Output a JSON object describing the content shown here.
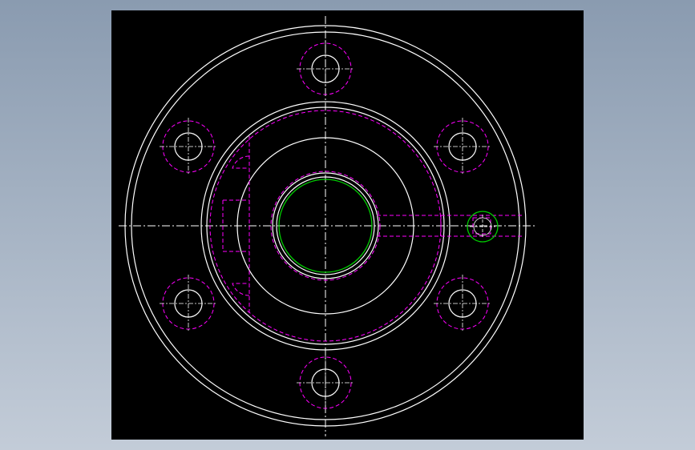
{
  "viewport": {
    "background": "#000000",
    "colors": {
      "outline": "#ffffff",
      "hidden": "#ff00ff",
      "center": "#ffffff",
      "highlight": "#00cc00"
    }
  },
  "drawing": {
    "kind": "flange-top-view",
    "bolt_hole_count": 6,
    "bolt_hole_style": "solid-inner-dashed-outer",
    "bore_highlighted": true,
    "side_port": "right",
    "centerlines": true
  }
}
